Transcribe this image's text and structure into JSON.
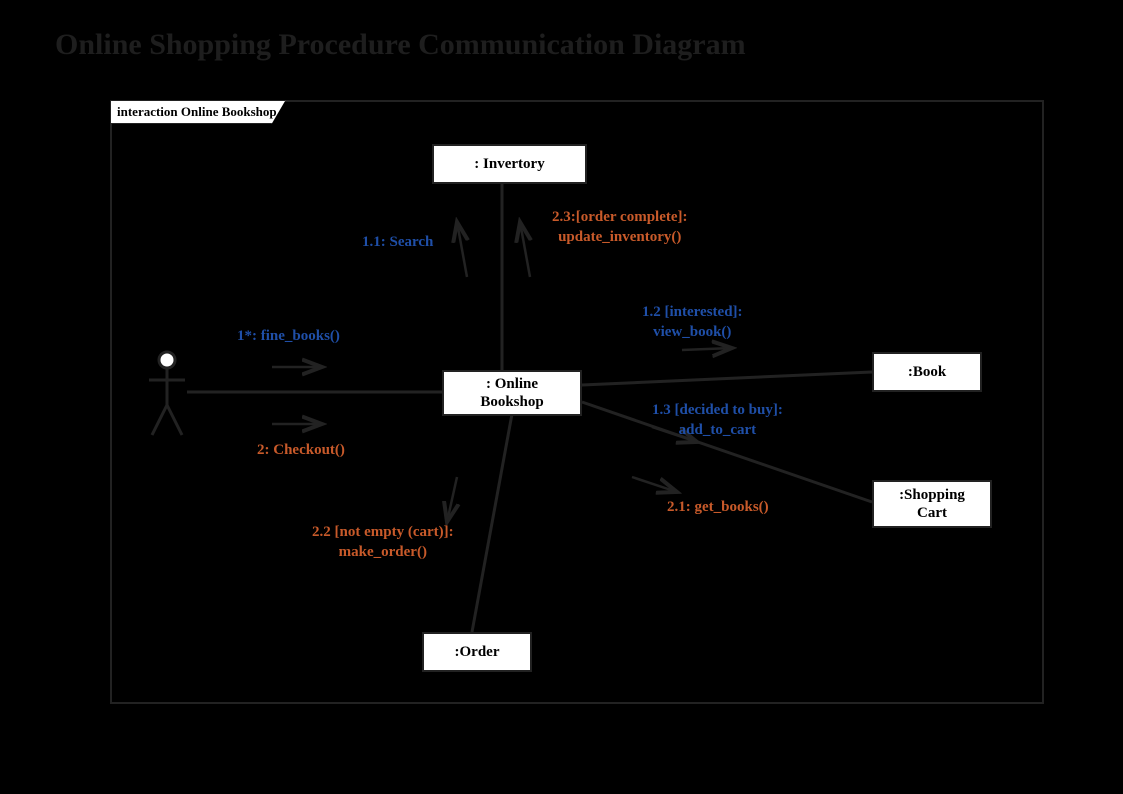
{
  "title": "Online Shopping Procedure Communication Diagram",
  "frame_label": "interaction Online Bookshop",
  "nodes": {
    "inventory": ": Invertory",
    "online_bookshop": ": Online\nBookshop",
    "book": ":Book",
    "shopping_cart": ":Shopping\nCart",
    "order": ":Order"
  },
  "messages": {
    "m1": "1*: fine_books()",
    "m2": "2: Checkout()",
    "m11": "1.1: Search",
    "m23": "2.3:[order complete]:\nupdate_inventory()",
    "m12": "1.2 [interested]:\nview_book()",
    "m13": "1.3 [decided to buy]:\nadd_to_cart",
    "m21": "2.1: get_books()",
    "m22": "2.2 [not empty (cart)]:\nmake_order()"
  }
}
